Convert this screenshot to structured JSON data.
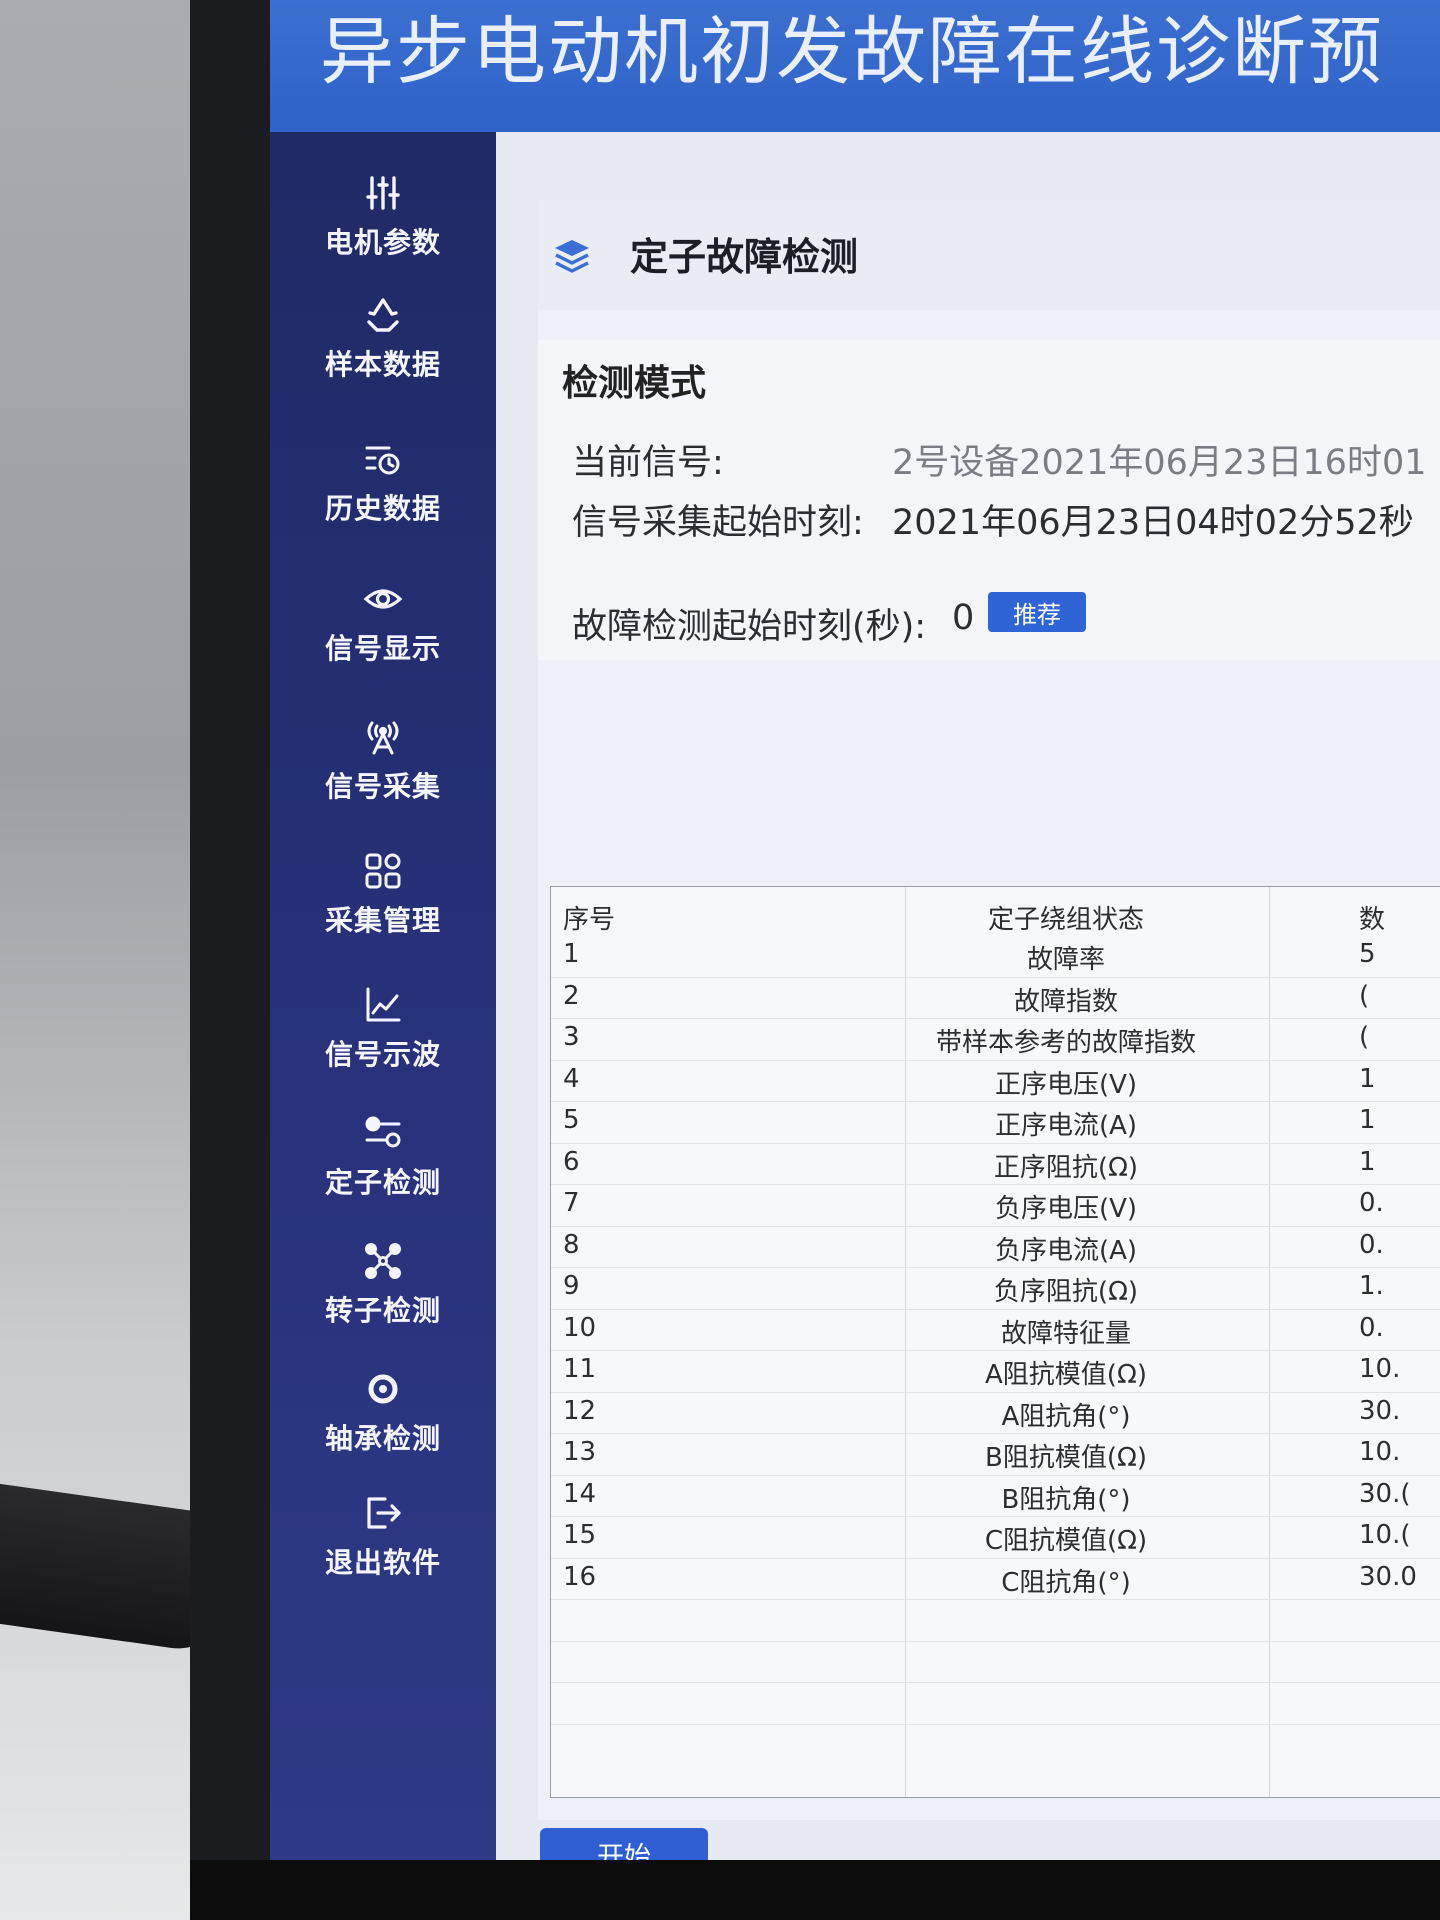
{
  "app": {
    "title": "异步电动机初发故障在线诊断预"
  },
  "sidebar": {
    "items": [
      {
        "label": "电机参数",
        "icon": "sliders-icon"
      },
      {
        "label": "样本数据",
        "icon": "recycle-icon"
      },
      {
        "label": "历史数据",
        "icon": "history-icon"
      },
      {
        "label": "信号显示",
        "icon": "eye-icon"
      },
      {
        "label": "信号采集",
        "icon": "antenna-icon"
      },
      {
        "label": "采集管理",
        "icon": "grid-icon"
      },
      {
        "label": "信号示波",
        "icon": "line-chart-icon"
      },
      {
        "label": "定子检测",
        "icon": "toggle-icon"
      },
      {
        "label": "转子检测",
        "icon": "nodes-icon"
      },
      {
        "label": "轴承检测",
        "icon": "bearing-icon"
      },
      {
        "label": "退出软件",
        "icon": "logout-icon"
      }
    ]
  },
  "page": {
    "heading": "定子故障检测"
  },
  "detection": {
    "title": "检测模式",
    "current_signal_label": "当前信号:",
    "current_signal_value": "2号设备2021年06月23日16时01",
    "start_time_label": "信号采集起始时刻:",
    "start_time_value": "2021年06月23日04时02分52秒",
    "fault_start_label": "故障检测起始时刻(秒):",
    "fault_start_value": "0",
    "recommend_button": "推荐"
  },
  "table": {
    "headers": [
      "序号",
      "定子绕组状态",
      "数"
    ],
    "rows": [
      [
        "1",
        "故障率",
        "5"
      ],
      [
        "2",
        "故障指数",
        "("
      ],
      [
        "3",
        "带样本参考的故障指数",
        "("
      ],
      [
        "4",
        "正序电压(V)",
        "1"
      ],
      [
        "5",
        "正序电流(A)",
        "1"
      ],
      [
        "6",
        "正序阻抗(Ω)",
        "1"
      ],
      [
        "7",
        "负序电压(V)",
        "0."
      ],
      [
        "8",
        "负序电流(A)",
        "0."
      ],
      [
        "9",
        "负序阻抗(Ω)",
        "1."
      ],
      [
        "10",
        "故障特征量",
        "0."
      ],
      [
        "11",
        "A阻抗模值(Ω)",
        "10."
      ],
      [
        "12",
        "A阻抗角(°)",
        "30."
      ],
      [
        "13",
        "B阻抗模值(Ω)",
        "10."
      ],
      [
        "14",
        "B阻抗角(°)",
        "30.("
      ],
      [
        "15",
        "C阻抗模值(Ω)",
        "10.("
      ],
      [
        "16",
        "C阻抗角(°)",
        "30.0"
      ]
    ]
  },
  "actions": {
    "start_button": "开始"
  },
  "colors": {
    "title_bar": "#2f62c8",
    "sidebar": "#1f2a66",
    "button": "#2f64d6"
  }
}
